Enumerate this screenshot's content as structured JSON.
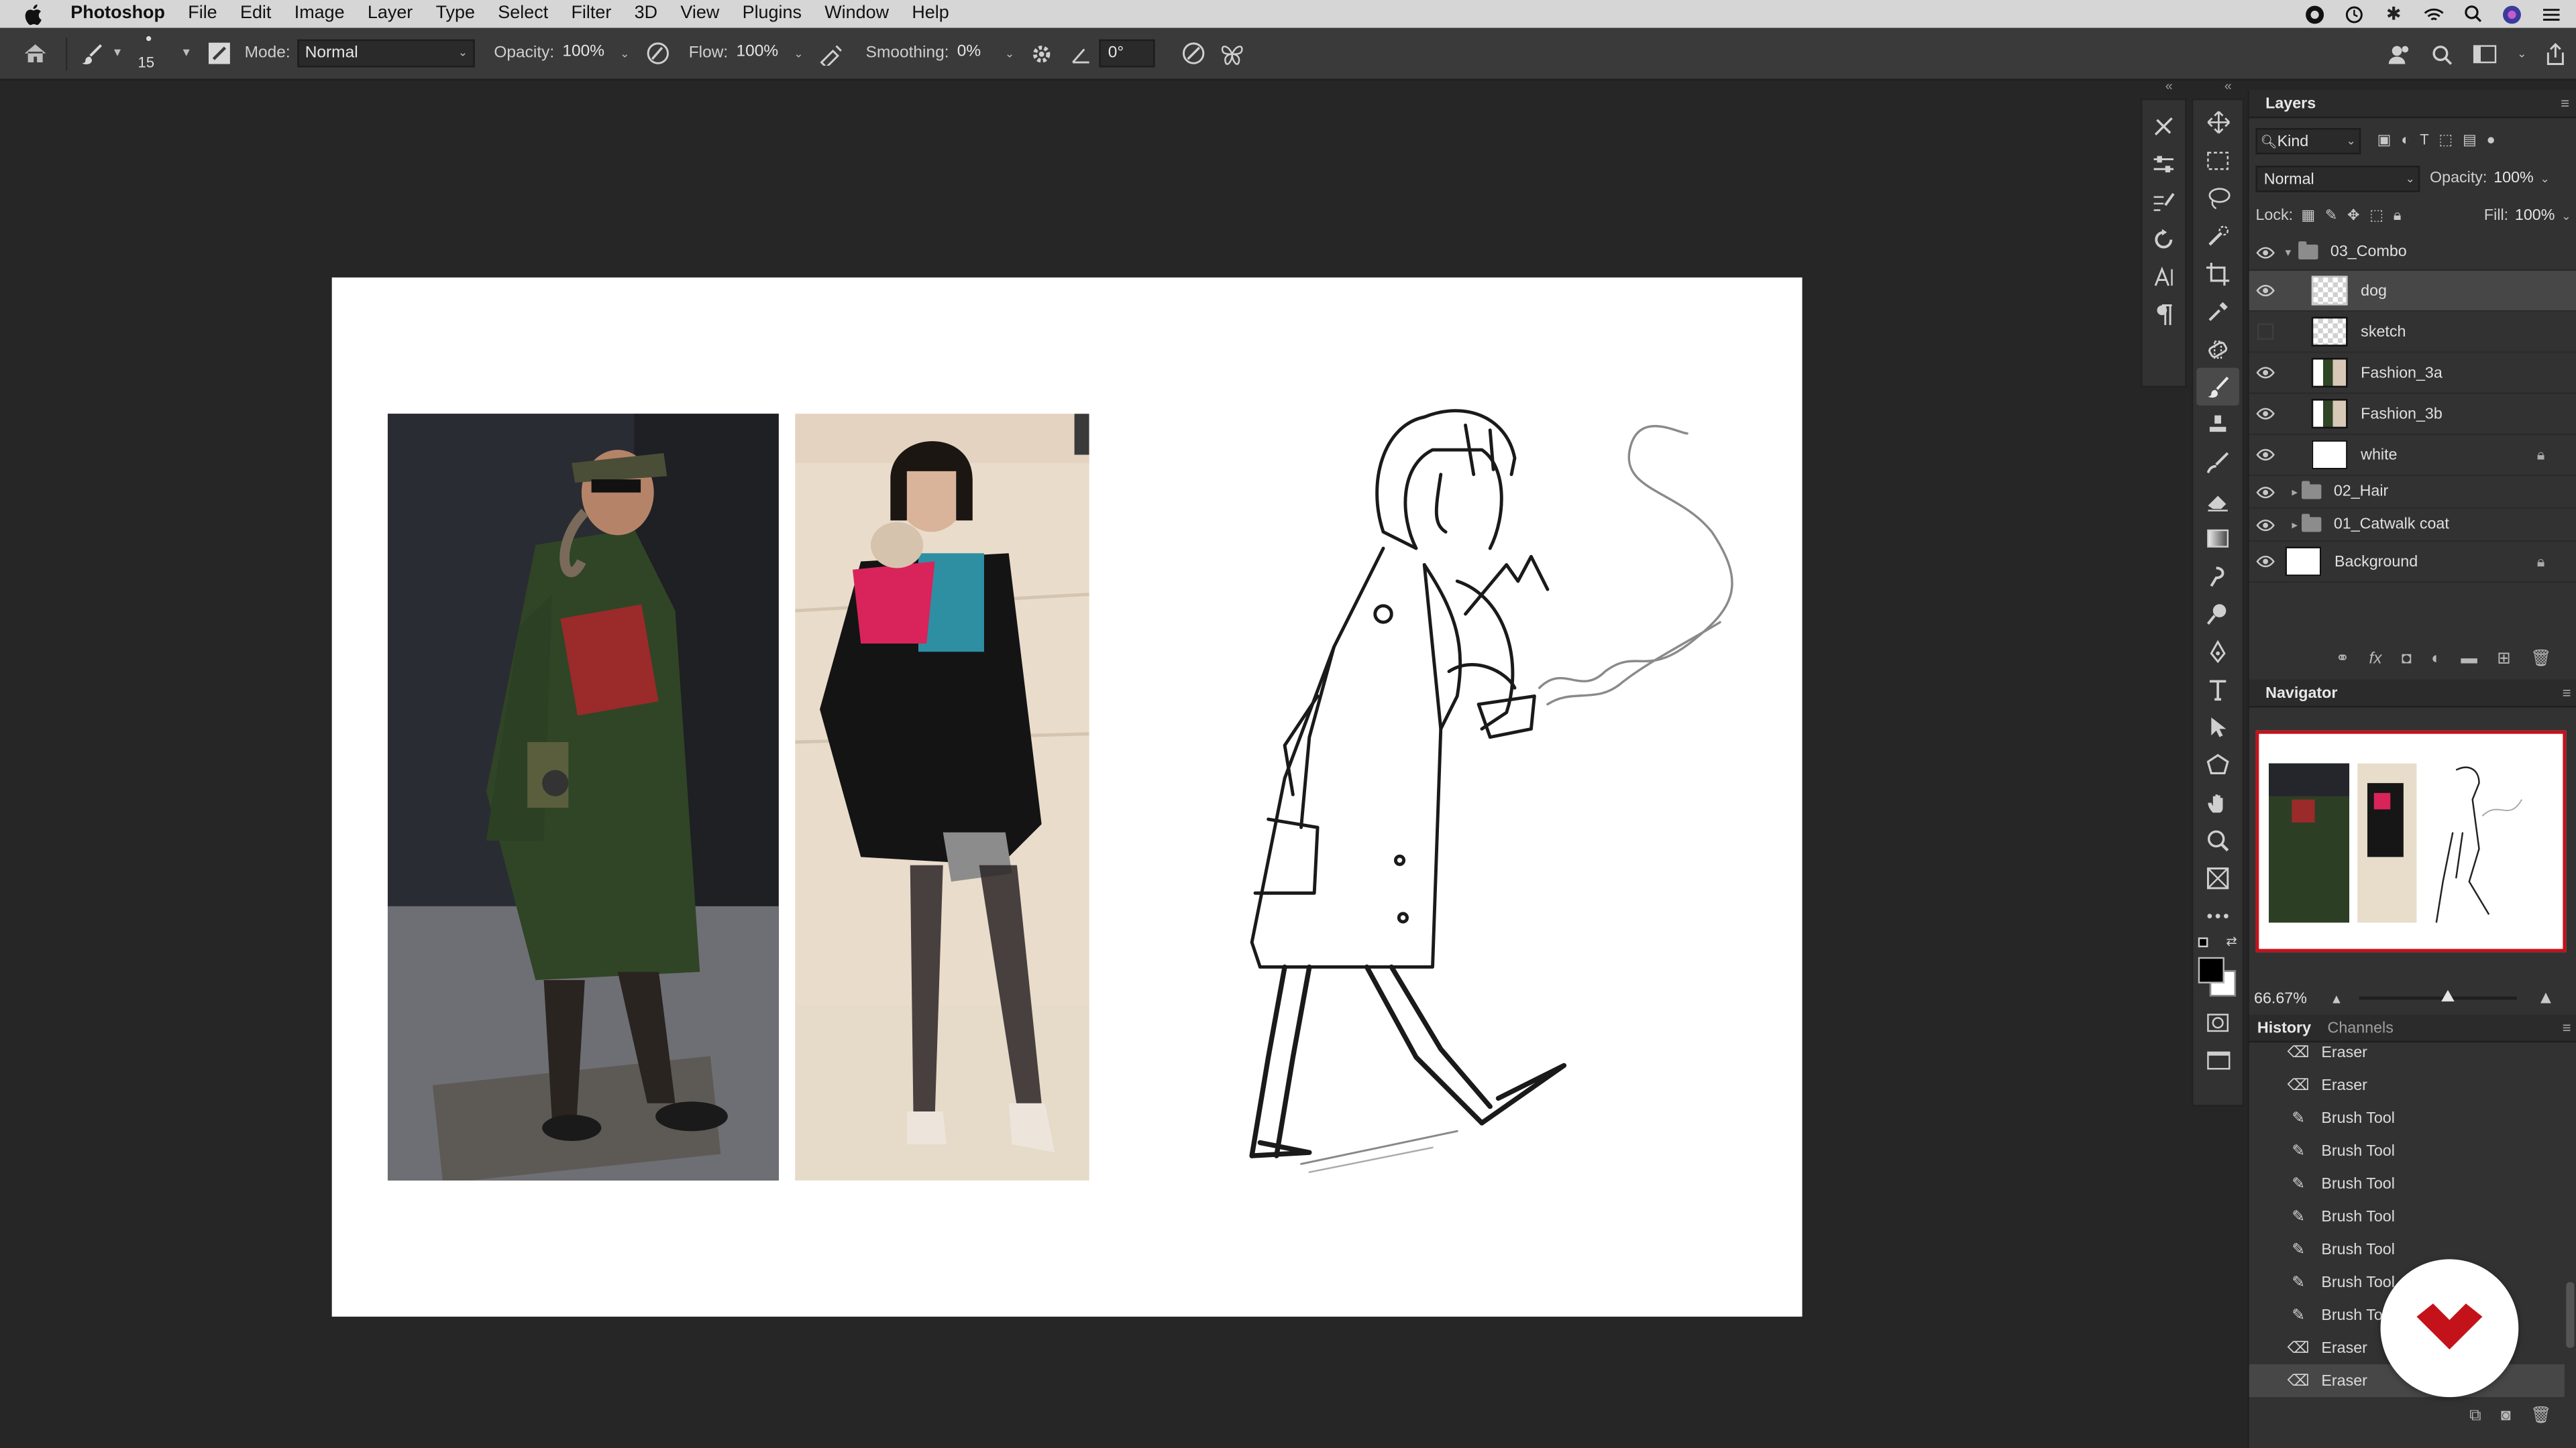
{
  "menubar": {
    "app_name": "Photoshop",
    "menus": [
      "File",
      "Edit",
      "Image",
      "Layer",
      "Type",
      "Select",
      "Filter",
      "3D",
      "View",
      "Plugins",
      "Window",
      "Help"
    ]
  },
  "options_bar": {
    "brush_size": "15",
    "mode_label": "Mode:",
    "mode_value": "Normal",
    "opacity_label": "Opacity:",
    "opacity_value": "100%",
    "flow_label": "Flow:",
    "flow_value": "100%",
    "smoothing_label": "Smoothing:",
    "smoothing_value": "0%",
    "angle_value": "0°"
  },
  "layers_panel": {
    "title": "Layers",
    "filter_kind": "Kind",
    "blend_mode": "Normal",
    "opacity_label": "Opacity:",
    "opacity_value": "100%",
    "lock_label": "Lock:",
    "fill_label": "Fill:",
    "fill_value": "100%",
    "layers": [
      {
        "name": "03_Combo",
        "type": "group",
        "expanded": true,
        "visible": true
      },
      {
        "name": "dog",
        "type": "layer",
        "visible": true,
        "selected": true
      },
      {
        "name": "sketch",
        "type": "layer",
        "visible": false
      },
      {
        "name": "Fashion_3a",
        "type": "layer",
        "visible": true
      },
      {
        "name": "Fashion_3b",
        "type": "layer",
        "visible": true
      },
      {
        "name": "white",
        "type": "layer",
        "visible": true,
        "locked": true
      },
      {
        "name": "02_Hair",
        "type": "group",
        "expanded": false,
        "visible": true
      },
      {
        "name": "01_Catwalk coat",
        "type": "group",
        "expanded": false,
        "visible": true
      },
      {
        "name": "Background",
        "type": "layer",
        "visible": true,
        "locked": true
      }
    ]
  },
  "navigator": {
    "title": "Navigator",
    "zoom": "66.67%"
  },
  "history_panel": {
    "tabs": [
      "History",
      "Channels"
    ],
    "items": [
      {
        "label": "Eraser",
        "icon": "eraser-icon"
      },
      {
        "label": "Eraser",
        "icon": "eraser-icon"
      },
      {
        "label": "Brush Tool",
        "icon": "brush-icon"
      },
      {
        "label": "Brush Tool",
        "icon": "brush-icon"
      },
      {
        "label": "Brush Tool",
        "icon": "brush-icon"
      },
      {
        "label": "Brush Tool",
        "icon": "brush-icon"
      },
      {
        "label": "Brush Tool",
        "icon": "brush-icon"
      },
      {
        "label": "Brush Tool",
        "icon": "brush-icon"
      },
      {
        "label": "Brush Tool",
        "icon": "brush-icon"
      },
      {
        "label": "Eraser",
        "icon": "eraser-icon"
      },
      {
        "label": "Eraser",
        "icon": "eraser-icon",
        "current": true
      }
    ]
  },
  "colors": {
    "accent_red": "#c4121b",
    "selection": "#474747",
    "panel_bg": "#323232"
  }
}
